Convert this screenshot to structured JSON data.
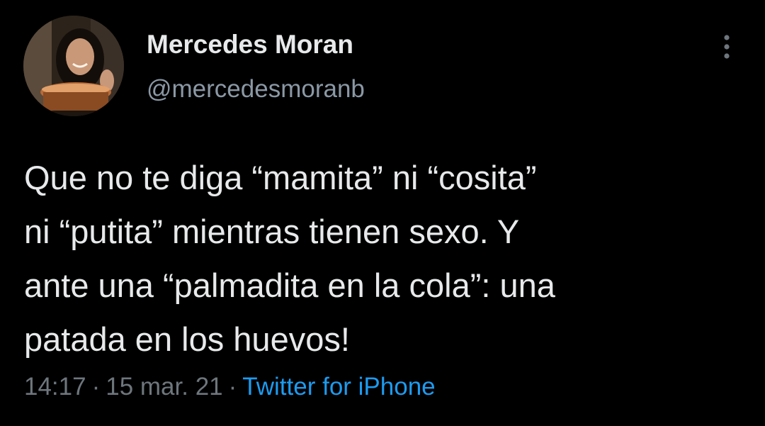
{
  "user": {
    "display_name": "Mercedes Moran",
    "handle": "@mercedesmoranb"
  },
  "tweet": {
    "text_lines": [
      "Que no te diga “mamita” ni “cosita”",
      "ni “putita” mientras tienen sexo. Y",
      "ante una “palmadita en la cola”: una",
      "patada en los huevos!"
    ]
  },
  "meta": {
    "time": "14:17",
    "separator": "·",
    "date": "15 mar. 21",
    "source": "Twitter for iPhone"
  },
  "icons": {
    "more": "more-vertical-icon"
  },
  "colors": {
    "background": "#000000",
    "text": "#e7e9ea",
    "secondary": "#8b98a5",
    "link": "#1d9bf0"
  }
}
